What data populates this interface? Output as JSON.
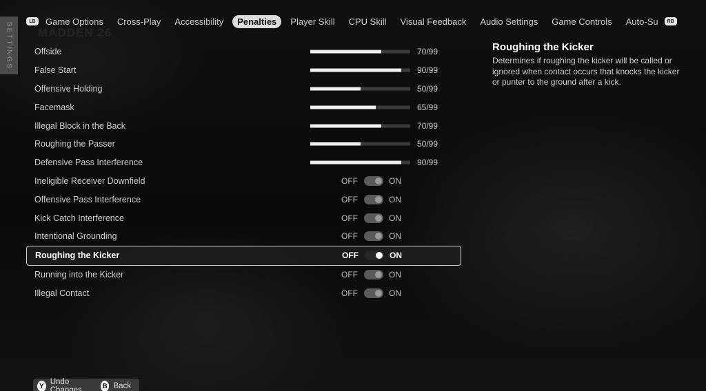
{
  "side_tab": {
    "label": "SETTINGS"
  },
  "watermark": "MADDEN 26",
  "tabs": {
    "left_bumper": "LB",
    "right_bumper": "RB",
    "items": [
      {
        "label": "Game Options"
      },
      {
        "label": "Cross-Play"
      },
      {
        "label": "Accessibility"
      },
      {
        "label": "Penalties"
      },
      {
        "label": "Player Skill"
      },
      {
        "label": "CPU Skill"
      },
      {
        "label": "Visual Feedback"
      },
      {
        "label": "Audio Settings"
      },
      {
        "label": "Game Controls"
      },
      {
        "label": "Auto-Su"
      }
    ],
    "active_index": 3
  },
  "sliders": [
    {
      "label": "Offside",
      "value": 70,
      "max": 99,
      "display": "70/99"
    },
    {
      "label": "False Start",
      "value": 90,
      "max": 99,
      "display": "90/99"
    },
    {
      "label": "Offensive Holding",
      "value": 50,
      "max": 99,
      "display": "50/99"
    },
    {
      "label": "Facemask",
      "value": 65,
      "max": 99,
      "display": "65/99"
    },
    {
      "label": "Illegal Block in the Back",
      "value": 70,
      "max": 99,
      "display": "70/99"
    },
    {
      "label": "Roughing the Passer",
      "value": 50,
      "max": 99,
      "display": "50/99"
    },
    {
      "label": "Defensive Pass Interference",
      "value": 90,
      "max": 99,
      "display": "90/99"
    }
  ],
  "toggles": [
    {
      "label": "Ineligible Receiver Downfield",
      "off_label": "OFF",
      "on_label": "ON",
      "state": "on",
      "selected": false
    },
    {
      "label": "Offensive Pass Interference",
      "off_label": "OFF",
      "on_label": "ON",
      "state": "on",
      "selected": false
    },
    {
      "label": "Kick Catch Interference",
      "off_label": "OFF",
      "on_label": "ON",
      "state": "on",
      "selected": false
    },
    {
      "label": "Intentional Grounding",
      "off_label": "OFF",
      "on_label": "ON",
      "state": "on",
      "selected": false
    },
    {
      "label": "Roughing the Kicker",
      "off_label": "OFF",
      "on_label": "ON",
      "state": "on",
      "selected": true
    },
    {
      "label": "Running into the Kicker",
      "off_label": "OFF",
      "on_label": "ON",
      "state": "on",
      "selected": false
    },
    {
      "label": "Illegal Contact",
      "off_label": "OFF",
      "on_label": "ON",
      "state": "on",
      "selected": false
    }
  ],
  "description": {
    "title": "Roughing the Kicker",
    "body": "Determines if roughing the kicker will be called or ignored when contact occurs that knocks the kicker or punter to the ground after a kick."
  },
  "footer": {
    "undo": {
      "button": "Y",
      "label": "Undo Changes"
    },
    "back": {
      "button": "B",
      "label": "Back"
    }
  }
}
